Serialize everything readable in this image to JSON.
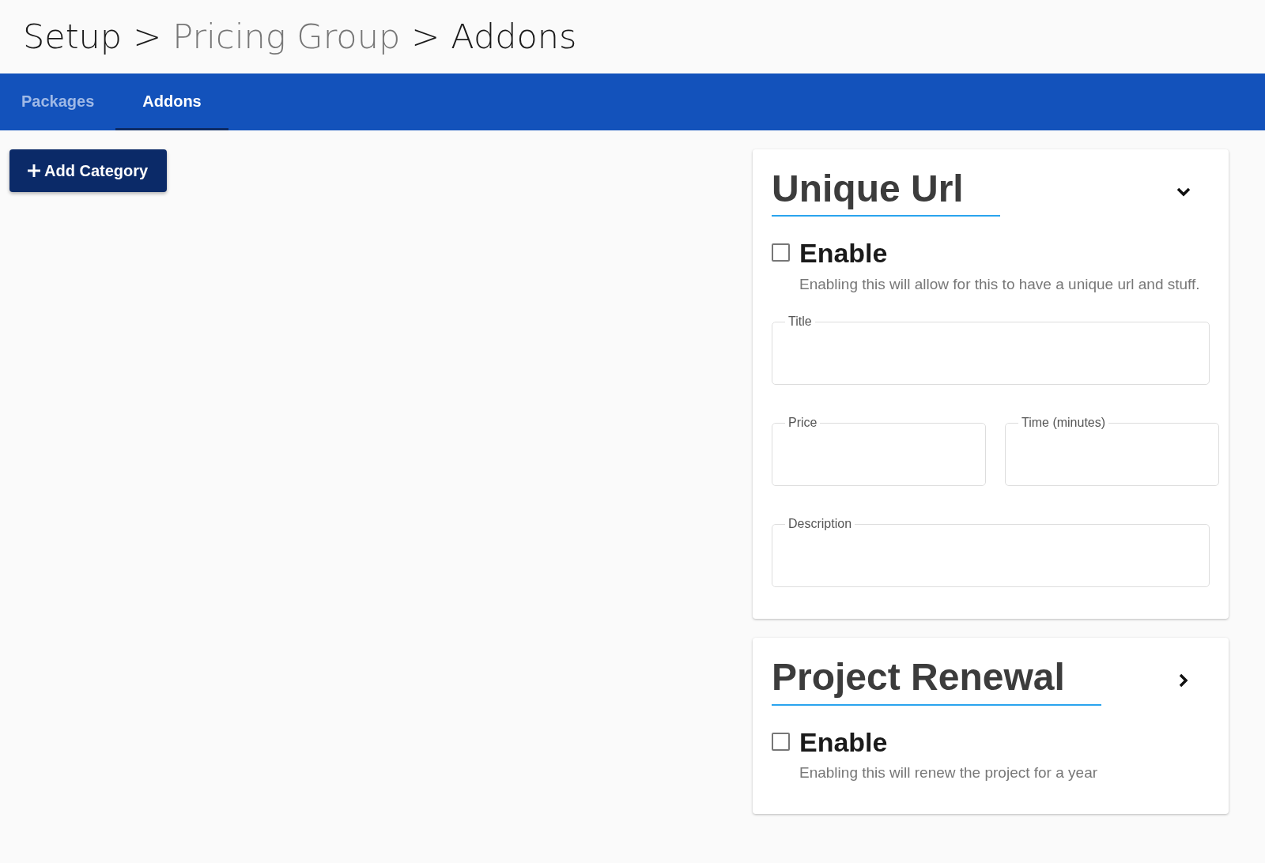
{
  "breadcrumb": [
    {
      "text": "Setup",
      "kind": "plain"
    },
    {
      "text": ">",
      "kind": "separator"
    },
    {
      "text": "Pricing Group",
      "kind": "link"
    },
    {
      "text": ">",
      "kind": "separator"
    },
    {
      "text": "Addons",
      "kind": "plain"
    }
  ],
  "tabs": [
    {
      "label": "Packages",
      "selected": false
    },
    {
      "label": "Addons",
      "selected": true
    }
  ],
  "add_button": {
    "label": "Add Category"
  },
  "addons": [
    {
      "title": "Unique Url",
      "expanded": true,
      "enable": {
        "label": "Enable",
        "checked": false,
        "description": "Enabling this will allow for this to have a unique url and stuff."
      },
      "field_rows": [
        [
          {
            "label": "Title"
          }
        ],
        [
          {
            "label": "Price"
          },
          {
            "label": "Time (minutes)"
          }
        ],
        [
          {
            "label": "Description"
          }
        ]
      ]
    },
    {
      "title": "Project Renewal",
      "expanded": false,
      "enable": {
        "label": "Enable",
        "checked": false,
        "description": "Enabling this will renew the project for a year"
      }
    }
  ]
}
